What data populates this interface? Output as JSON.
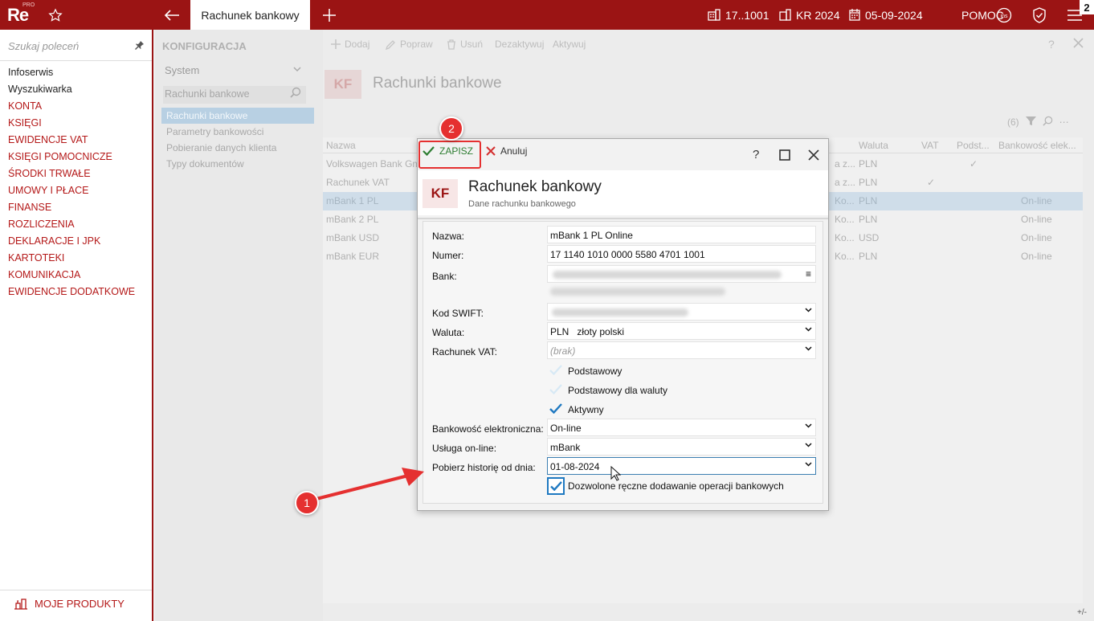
{
  "topbar": {
    "tab_title": "Rachunek bankowy",
    "logo": "Re",
    "logo_suffix": "PRO",
    "company": "17..1001",
    "period": "KR 2024",
    "date": "05-09-2024",
    "help": "POMOC",
    "notifications": "2",
    "ins_label": "ins"
  },
  "sidebar": {
    "search_placeholder": "Szukaj poleceń",
    "items": [
      {
        "label": "Infoserwis",
        "style": "dark"
      },
      {
        "label": "Wyszukiwarka",
        "style": "dark"
      },
      {
        "label": "KONTA",
        "style": "red"
      },
      {
        "label": "KSIĘGI",
        "style": "red"
      },
      {
        "label": "EWIDENCJE VAT",
        "style": "red"
      },
      {
        "label": "KSIĘGI POMOCNICZE",
        "style": "red"
      },
      {
        "label": "ŚRODKI TRWAŁE",
        "style": "red"
      },
      {
        "label": "UMOWY I PŁACE",
        "style": "red"
      },
      {
        "label": "FINANSE",
        "style": "red"
      },
      {
        "label": "ROZLICZENIA",
        "style": "red"
      },
      {
        "label": "DEKLARACJE I JPK",
        "style": "red"
      },
      {
        "label": "KARTOTEKI",
        "style": "red"
      },
      {
        "label": "KOMUNIKACJA",
        "style": "red"
      },
      {
        "label": "EWIDENCJE DODATKOWE",
        "style": "red"
      }
    ],
    "bottom_label": "MOJE PRODUKTY"
  },
  "config": {
    "title": "KONFIGURACJA",
    "group": "System",
    "search_value": "Rachunki bankowe",
    "items": [
      {
        "label": "Rachunki bankowe",
        "selected": true
      },
      {
        "label": "Parametry bankowości",
        "selected": false
      },
      {
        "label": "Pobieranie danych klienta",
        "selected": false
      },
      {
        "label": "Typy dokumentów",
        "selected": false
      }
    ]
  },
  "main": {
    "toolbar": [
      "Dodaj",
      "Popraw",
      "Usuń",
      "Dezaktywuj",
      "Aktywuj"
    ],
    "kf_badge": "KF",
    "title": "Rachunki bankowe",
    "record_count": "(6)",
    "columns": [
      "Nazwa",
      "Waluta",
      "VAT",
      "Podst...",
      "Bankowość elek..."
    ],
    "rows": [
      {
        "name": "Volkswagen Bank Gm",
        "mid": "a z...",
        "currency": "PLN",
        "vat": "",
        "podst": "✓",
        "bank": "",
        "selected": false
      },
      {
        "name": "Rachunek VAT",
        "mid": "a z...",
        "currency": "PLN",
        "vat": "✓",
        "podst": "",
        "bank": "",
        "selected": false
      },
      {
        "name": "mBank 1 PL",
        "mid": "Ko...",
        "currency": "PLN",
        "vat": "",
        "podst": "",
        "bank": "On-line",
        "selected": true
      },
      {
        "name": "mBank 2 PL",
        "mid": "Ko...",
        "currency": "PLN",
        "vat": "",
        "podst": "",
        "bank": "On-line",
        "selected": false
      },
      {
        "name": "mBank USD",
        "mid": "Ko...",
        "currency": "USD",
        "vat": "",
        "podst": "",
        "bank": "On-line",
        "selected": false
      },
      {
        "name": "mBank EUR",
        "mid": "Ko...",
        "currency": "PLN",
        "vat": "",
        "podst": "",
        "bank": "On-line",
        "selected": false
      }
    ]
  },
  "dialog": {
    "save_label": "ZAPISZ",
    "cancel_label": "Anuluj",
    "help_label": "?",
    "kf_badge": "KF",
    "title": "Rachunek bankowy",
    "subtitle": "Dane rachunku bankowego",
    "fields": {
      "nazwa_label": "Nazwa:",
      "nazwa_value": "mBank 1 PL Online",
      "numer_label": "Numer:",
      "numer_value": "17 1140 1010 0000 5580 4701 1001",
      "bank_label": "Bank:",
      "swift_label": "Kod SWIFT:",
      "waluta_label": "Waluta:",
      "waluta_value": "PLN   złoty polski",
      "vat_label": "Rachunek VAT:",
      "vat_value": "(brak)",
      "podstawowy_label": "Podstawowy",
      "podstawowy_waluty_label": "Podstawowy dla waluty",
      "aktywny_label": "Aktywny",
      "bankowosc_label": "Bankowość elektroniczna:",
      "bankowosc_value": "On-line",
      "usluga_label": "Usługa on-line:",
      "usluga_value": "mBank",
      "pobierz_label": "Pobierz historię od dnia:",
      "pobierz_value": "01-08-2024",
      "dozwolone_label": "Dozwolone ręczne dodawanie operacji bankowych"
    },
    "checkboxes": {
      "podstawowy": false,
      "podstawowy_waluty": false,
      "aktywny": true,
      "dozwolone": true
    }
  },
  "annotations": {
    "step1": "1",
    "step2": "2"
  },
  "footer": {
    "corner": "+/-"
  },
  "colors": {
    "brand": "#9b1414",
    "annotation": "#e53030",
    "accent_blue": "#1f79c1",
    "save_green": "#2e7d32"
  }
}
